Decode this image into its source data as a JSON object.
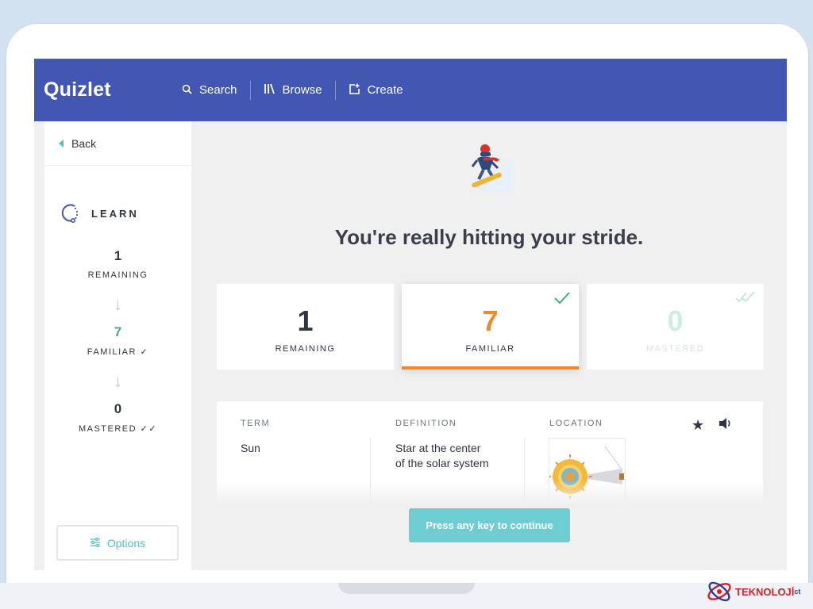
{
  "header": {
    "logo": "Quizlet",
    "nav": [
      {
        "label": "Search",
        "icon": "search-icon"
      },
      {
        "label": "Browse",
        "icon": "browse-icon"
      },
      {
        "label": "Create",
        "icon": "create-icon"
      }
    ]
  },
  "sidebar": {
    "back_label": "Back",
    "mode_label": "LEARN",
    "remaining": {
      "value": "1",
      "label": "REMAINING"
    },
    "familiar": {
      "value": "7",
      "label": "FAMILIAR ✓"
    },
    "mastered": {
      "value": "0",
      "label": "MASTERED ✓✓"
    },
    "options_label": "Options"
  },
  "main": {
    "headline": "You're really hitting your stride.",
    "cards": [
      {
        "value": "1",
        "label": "REMAINING"
      },
      {
        "value": "7",
        "label": "FAMILIAR"
      },
      {
        "value": "0",
        "label": "MASTERED"
      }
    ],
    "term": {
      "term_header": "TERM",
      "term_value": "Sun",
      "definition_header": "DEFINITION",
      "definition_value_line1": "Star at the center",
      "definition_value_line2": "of the solar system",
      "location_header": "LOCATION"
    },
    "continue_label": "Press any key to continue"
  },
  "watermark": {
    "text": "TEKNOLOJİ",
    "suffix": "ct"
  },
  "colors": {
    "brand": "#4257b2",
    "accent": "#4ec2c6",
    "familiar": "#ef8a2b",
    "familiar_sidebar": "#3fb07a",
    "mastered": "#cdeee0",
    "continue": "#6dcdd1"
  }
}
